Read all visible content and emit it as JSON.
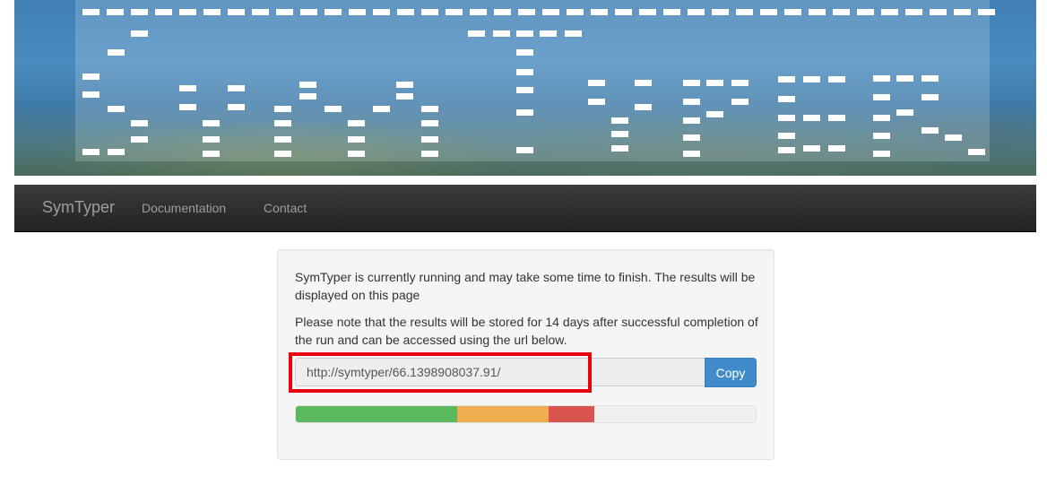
{
  "banner": {
    "logo_alt": "SymTyper"
  },
  "navbar": {
    "brand": "SymTyper",
    "links": [
      {
        "label": "Documentation"
      },
      {
        "label": "Contact"
      }
    ]
  },
  "status": {
    "message_running": "SymTyper is currently running and may take some time to finish. The results will be displayed on this page",
    "message_storage": "Please note that the results will be stored for 14 days after successful completion of the run and can be accessed using the url below.",
    "url_value": "http://symtyper/66.1398908037.91/",
    "copy_label": "Copy"
  },
  "progress": {
    "segments": [
      {
        "name": "success",
        "percent": 35,
        "color": "#5cb85c"
      },
      {
        "name": "warning",
        "percent": 20,
        "color": "#f0ad4e"
      },
      {
        "name": "danger",
        "percent": 10,
        "color": "#d9534f"
      }
    ]
  },
  "colors": {
    "navbar_bg": "#222222",
    "primary": "#428bca",
    "highlight": "#e8000f"
  }
}
